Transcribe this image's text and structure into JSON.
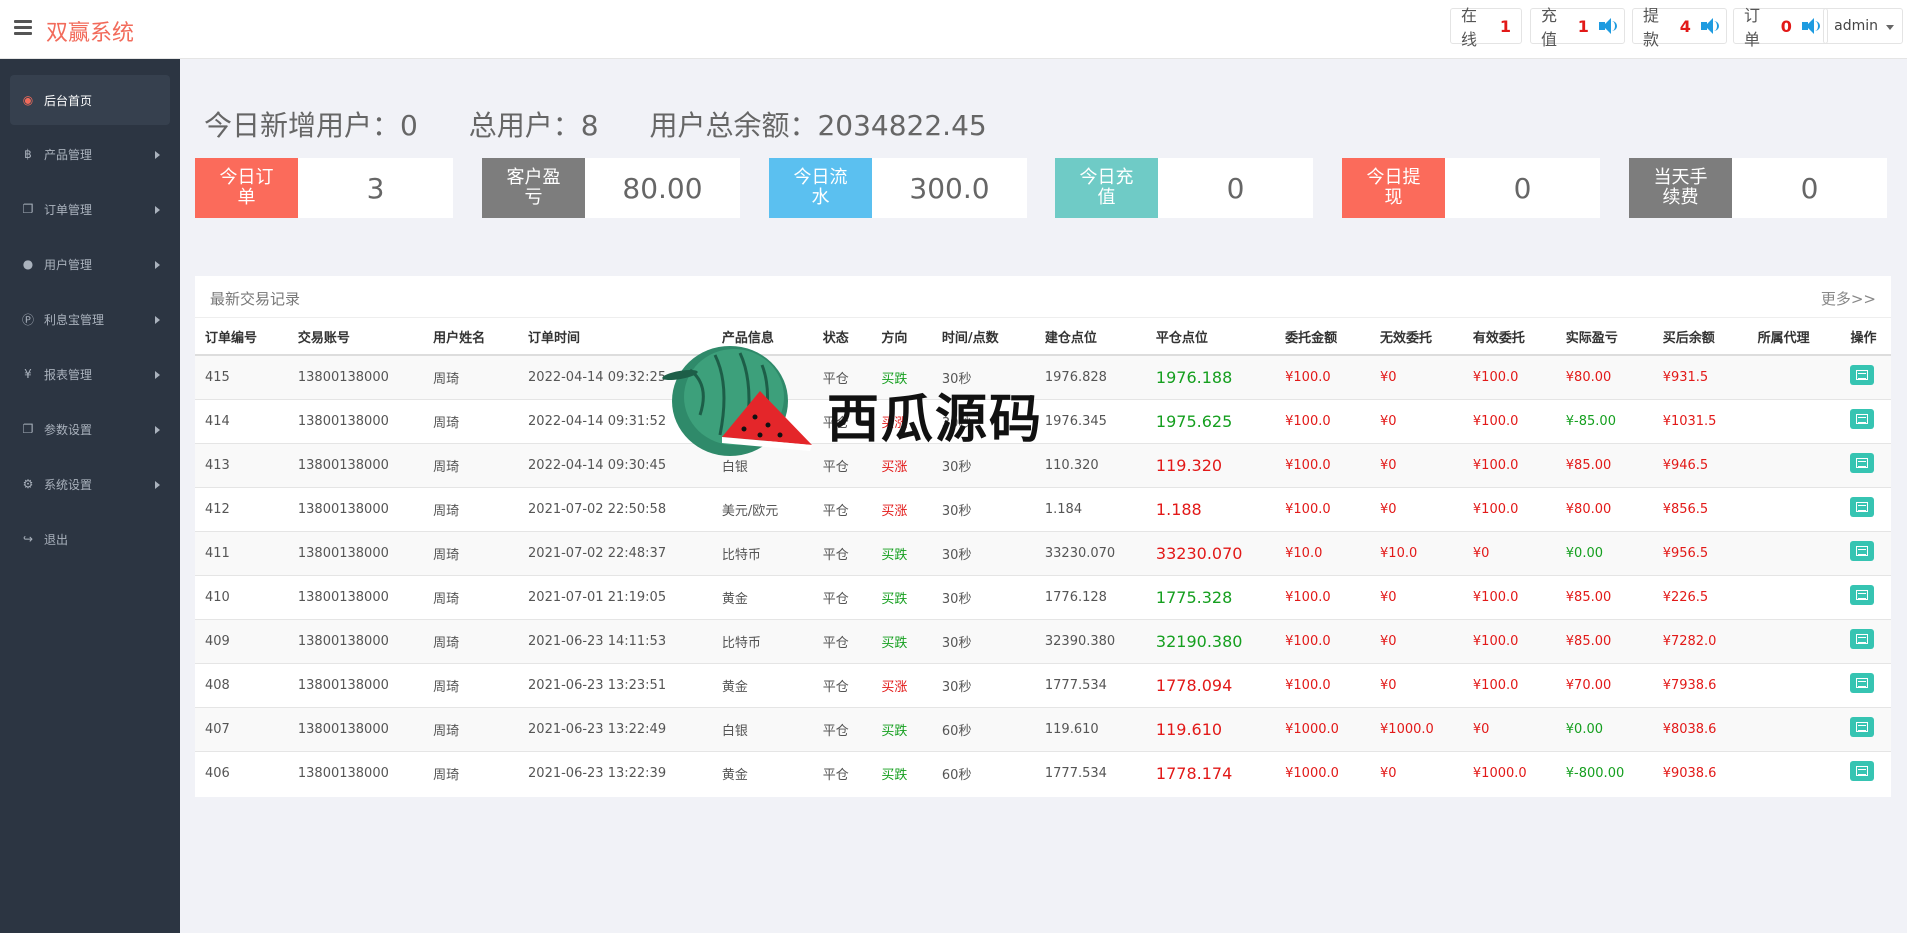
{
  "header": {
    "brand": "双赢系统",
    "online_label": "在线",
    "online_count": "1",
    "recharge_label": "充值",
    "recharge_count": "1",
    "withdraw_label": "提款",
    "withdraw_count": "4",
    "order_label": "订单",
    "order_count": "0",
    "user": "admin"
  },
  "sidebar": {
    "items": [
      {
        "label": "后台首页",
        "icon": "dashboard-icon"
      },
      {
        "label": "产品管理",
        "icon": "bitcoin-icon"
      },
      {
        "label": "订单管理",
        "icon": "copy-icon"
      },
      {
        "label": "用户管理",
        "icon": "user-icon"
      },
      {
        "label": "利息宝管理",
        "icon": "pinterest-icon"
      },
      {
        "label": "报表管理",
        "icon": "yen-icon"
      },
      {
        "label": "参数设置",
        "icon": "copy-icon"
      },
      {
        "label": "系统设置",
        "icon": "gears-icon"
      },
      {
        "label": "退出",
        "icon": "sign-out-icon"
      }
    ]
  },
  "summary": {
    "new_users": "今日新增用户：0",
    "total_users": "总用户：8",
    "total_balance": "用户总余额：2034822.45"
  },
  "cards": [
    {
      "label": "今日订单",
      "value": "3",
      "color": "#fb6b5b"
    },
    {
      "label": "客户盈亏",
      "value": "80.00",
      "color": "#7d7d7d"
    },
    {
      "label": "今日流水",
      "value": "300.0",
      "color": "#5bc0f0"
    },
    {
      "label": "今日充值",
      "value": "0",
      "color": "#6fcbc6"
    },
    {
      "label": "今日提现",
      "value": "0",
      "color": "#fb6b5b"
    },
    {
      "label": "当天手续费",
      "value": "0",
      "color": "#7d7d7d"
    }
  ],
  "panel": {
    "title": "最新交易记录",
    "more": "更多>>",
    "columns": [
      "订单编号",
      "交易账号",
      "用户姓名",
      "订单时间",
      "产品信息",
      "状态",
      "方向",
      "时间/点数",
      "建仓点位",
      "平仓点位",
      "委托金额",
      "无效委托",
      "有效委托",
      "实际盈亏",
      "买后余额",
      "所属代理",
      "操作"
    ],
    "rows": [
      {
        "id": "415",
        "acct": "13800138000",
        "name": "周琦",
        "time": "2022-04-14 09:32:25",
        "product": "",
        "status": "平仓",
        "dir": "买跌",
        "dur": "30秒",
        "open": "1976.828",
        "close": "1976.188",
        "amount": "¥100.0",
        "invalid": "¥0",
        "valid": "¥100.0",
        "pnl": "¥80.00",
        "balance": "¥931.5",
        "agent": ""
      },
      {
        "id": "414",
        "acct": "13800138000",
        "name": "周琦",
        "time": "2022-04-14 09:31:52",
        "product": "",
        "status": "平仓",
        "dir": "买涨",
        "dur": "30秒",
        "open": "1976.345",
        "close": "1975.625",
        "amount": "¥100.0",
        "invalid": "¥0",
        "valid": "¥100.0",
        "pnl": "¥-85.00",
        "balance": "¥1031.5",
        "agent": ""
      },
      {
        "id": "413",
        "acct": "13800138000",
        "name": "周琦",
        "time": "2022-04-14 09:30:45",
        "product": "白银",
        "status": "平仓",
        "dir": "买涨",
        "dur": "30秒",
        "open": "110.320",
        "close": "119.320",
        "amount": "¥100.0",
        "invalid": "¥0",
        "valid": "¥100.0",
        "pnl": "¥85.00",
        "balance": "¥946.5",
        "agent": ""
      },
      {
        "id": "412",
        "acct": "13800138000",
        "name": "周琦",
        "time": "2021-07-02 22:50:58",
        "product": "美元/欧元",
        "status": "平仓",
        "dir": "买涨",
        "dur": "30秒",
        "open": "1.184",
        "close": "1.188",
        "amount": "¥100.0",
        "invalid": "¥0",
        "valid": "¥100.0",
        "pnl": "¥80.00",
        "balance": "¥856.5",
        "agent": ""
      },
      {
        "id": "411",
        "acct": "13800138000",
        "name": "周琦",
        "time": "2021-07-02 22:48:37",
        "product": "比特币",
        "status": "平仓",
        "dir": "买跌",
        "dur": "30秒",
        "open": "33230.070",
        "close": "33230.070",
        "amount": "¥10.0",
        "invalid": "¥10.0",
        "valid": "¥0",
        "pnl": "¥0.00",
        "balance": "¥956.5",
        "agent": ""
      },
      {
        "id": "410",
        "acct": "13800138000",
        "name": "周琦",
        "time": "2021-07-01 21:19:05",
        "product": "黄金",
        "status": "平仓",
        "dir": "买跌",
        "dur": "30秒",
        "open": "1776.128",
        "close": "1775.328",
        "amount": "¥100.0",
        "invalid": "¥0",
        "valid": "¥100.0",
        "pnl": "¥85.00",
        "balance": "¥226.5",
        "agent": ""
      },
      {
        "id": "409",
        "acct": "13800138000",
        "name": "周琦",
        "time": "2021-06-23 14:11:53",
        "product": "比特币",
        "status": "平仓",
        "dir": "买跌",
        "dur": "30秒",
        "open": "32390.380",
        "close": "32190.380",
        "amount": "¥100.0",
        "invalid": "¥0",
        "valid": "¥100.0",
        "pnl": "¥85.00",
        "balance": "¥7282.0",
        "agent": ""
      },
      {
        "id": "408",
        "acct": "13800138000",
        "name": "周琦",
        "time": "2021-06-23 13:23:51",
        "product": "黄金",
        "status": "平仓",
        "dir": "买涨",
        "dur": "30秒",
        "open": "1777.534",
        "close": "1778.094",
        "amount": "¥100.0",
        "invalid": "¥0",
        "valid": "¥100.0",
        "pnl": "¥70.00",
        "balance": "¥7938.6",
        "agent": ""
      },
      {
        "id": "407",
        "acct": "13800138000",
        "name": "周琦",
        "time": "2021-06-23 13:22:49",
        "product": "白银",
        "status": "平仓",
        "dir": "买跌",
        "dur": "60秒",
        "open": "119.610",
        "close": "119.610",
        "amount": "¥1000.0",
        "invalid": "¥1000.0",
        "valid": "¥0",
        "pnl": "¥0.00",
        "balance": "¥8038.6",
        "agent": ""
      },
      {
        "id": "406",
        "acct": "13800138000",
        "name": "周琦",
        "time": "2021-06-23 13:22:39",
        "product": "黄金",
        "status": "平仓",
        "dir": "买跌",
        "dur": "60秒",
        "open": "1777.534",
        "close": "1778.174",
        "amount": "¥1000.0",
        "invalid": "¥0",
        "valid": "¥1000.0",
        "pnl": "¥-800.00",
        "balance": "¥9038.6",
        "agent": ""
      }
    ]
  },
  "watermark": {
    "text": "西瓜源码"
  },
  "colors": {
    "brand": "#f26b5b",
    "sidebar": "#2c3542",
    "up": "#e21918",
    "down": "#159f1f",
    "action": "#36c4b2"
  }
}
